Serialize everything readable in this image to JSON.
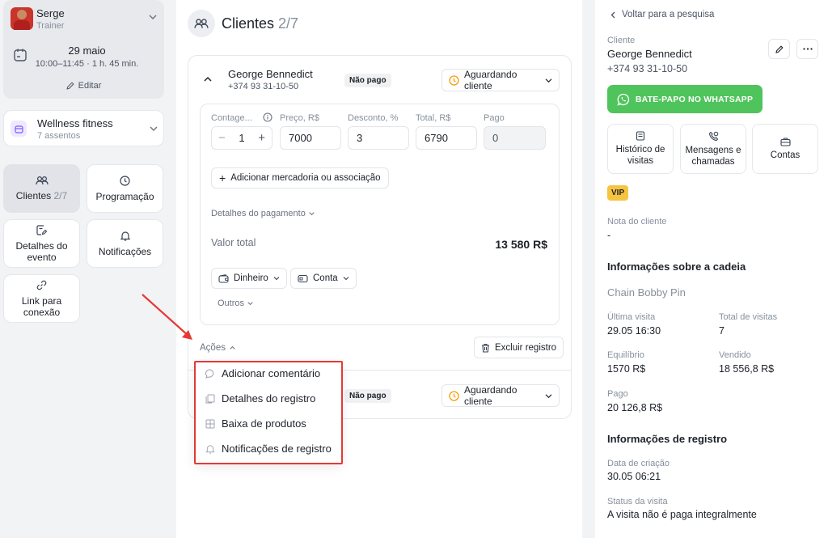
{
  "user": {
    "name": "Serge",
    "role": "Trainer"
  },
  "event": {
    "date": "29 maio",
    "time": "10:00–11:45 · 1 h. 45 min.",
    "edit_label": "Editar"
  },
  "facility": {
    "name": "Wellness fitness",
    "seats": "7 assentos"
  },
  "nav": {
    "clients": "Clientes",
    "clients_count": "2/7",
    "schedule": "Programação",
    "event_details": "Detalhes do evento",
    "notifications": "Notificações",
    "link": "Link para conexão"
  },
  "main": {
    "title": "Clientes",
    "count": "2/7",
    "entry": {
      "client_name": "George Bennedict",
      "phone": "+374 93 31-10-50",
      "payment_badge": "Não pago",
      "status": "Aguardando cliente"
    },
    "fields": {
      "qty_label": "Contage...",
      "qty_value": "1",
      "price_label": "Preço, R$",
      "price_value": "7000",
      "discount_label": "Desconto, %",
      "discount_value": "3",
      "total_label": "Total, R$",
      "total_value": "6790",
      "paid_label": "Pago",
      "paid_value": "0"
    },
    "add_goods": "Adicionar mercadoria ou associação",
    "payment_details": "Detalhes do pagamento",
    "total_value_label": "Valor total",
    "total_amount": "13 580 R$",
    "pay_cash": "Dinheiro",
    "pay_account": "Conta",
    "others": "Outros",
    "actions": "Ações",
    "delete": "Excluir registro",
    "entry2": {
      "payment_badge": "Não pago",
      "status": "Aguardando cliente"
    },
    "menu": [
      "Adicionar comentário",
      "Detalhes do registro",
      "Baixa de produtos",
      "Notificações de registro"
    ]
  },
  "panel": {
    "back": "Voltar para a pesquisa",
    "client_label": "Cliente",
    "client_name": "George Bennedict",
    "phone": "+374 93 31-10-50",
    "whatsapp": "BATE-PAPO NO WHATSAPP",
    "tiles": [
      "Histórico de visitas",
      "Mensagens e chamadas",
      "Contas"
    ],
    "vip": "VIP",
    "note_label": "Nota do cliente",
    "note_value": "-",
    "chain_heading": "Informações sobre a cadeia",
    "chain_name": "Chain Bobby Pin",
    "last_visit_label": "Última visita",
    "last_visit_value": "29.05 16:30",
    "total_visits_label": "Total de visitas",
    "total_visits_value": "7",
    "balance_label": "Equilíbrio",
    "balance_value": "1570 R$",
    "sold_label": "Vendido",
    "sold_value": "18 556,8 R$",
    "paid_label": "Pago",
    "paid_value": "20 126,8 R$",
    "record_heading": "Informações de registro",
    "created_label": "Data de criação",
    "created_value": "30.05 06:21",
    "visit_status_label": "Status da visita",
    "visit_status_value": "A visita não é paga integralmente"
  },
  "colors": {
    "whatsapp": "#4fc45c",
    "vip": "#f5c542",
    "highlight": "#e53935",
    "status_icon": "#f59f0b"
  }
}
